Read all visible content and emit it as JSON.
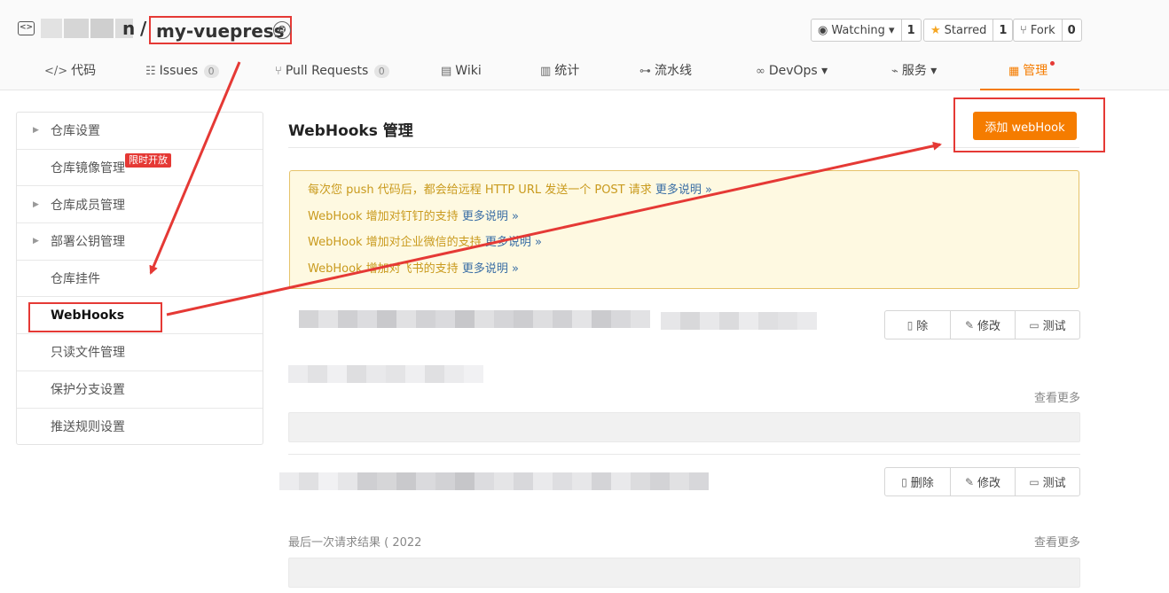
{
  "repo": {
    "owner_tail": "n",
    "separator": "/",
    "name": "my-vuepress"
  },
  "header_buttons": {
    "watching": {
      "label": "Watching ▾",
      "count": "1"
    },
    "starred": {
      "label": "Starred",
      "count": "1"
    },
    "fork": {
      "label": "Fork",
      "count": "0"
    }
  },
  "tabs": [
    {
      "icon": "</>",
      "label": "代码"
    },
    {
      "icon": "☷",
      "label": "Issues",
      "count": "0"
    },
    {
      "icon": "⑂",
      "label": "Pull Requests",
      "count": "0"
    },
    {
      "icon": "▤",
      "label": "Wiki"
    },
    {
      "icon": "▥",
      "label": "统计"
    },
    {
      "icon": "⊶",
      "label": "流水线"
    },
    {
      "icon": "∞",
      "label": "DevOps ▾"
    },
    {
      "icon": "⌁",
      "label": "服务 ▾"
    },
    {
      "icon": "▦",
      "label": "管理"
    }
  ],
  "sidebar": {
    "items": [
      {
        "label": "仓库设置",
        "caret": "▶"
      },
      {
        "label": "仓库镜像管理",
        "tag": "限时开放"
      },
      {
        "label": "仓库成员管理",
        "caret": "▶"
      },
      {
        "label": "部署公钥管理",
        "caret": "▶"
      },
      {
        "label": "仓库挂件"
      },
      {
        "label": "WebHooks"
      },
      {
        "label": "只读文件管理"
      },
      {
        "label": "保护分支设置"
      },
      {
        "label": "推送规则设置"
      }
    ]
  },
  "main": {
    "title": "WebHooks 管理",
    "add_button": "添加 webHook"
  },
  "notice": {
    "line1": "每次您 push 代码后，都会给远程 HTTP URL 发送一个 POST 请求",
    "line2": "WebHook 增加对钉钉的支持",
    "line3": "WebHook 增加对企业微信的支持",
    "line4": "WebHook 增加对飞书的支持",
    "link": "更多说明 »"
  },
  "hooks": [
    {
      "ops": {
        "delete": "除",
        "edit": "修改",
        "test": "测试"
      },
      "more": "查看更多"
    },
    {
      "ops": {
        "delete": "删除",
        "edit": "修改",
        "test": "测试"
      },
      "last_request": "最后一次请求结果 ( 2022",
      "more": "查看更多"
    }
  ],
  "colors": {
    "accent": "#f57c00",
    "annotation": "#e53935",
    "notice_bg": "#fef9e1",
    "notice_text": "#c99a1d"
  }
}
